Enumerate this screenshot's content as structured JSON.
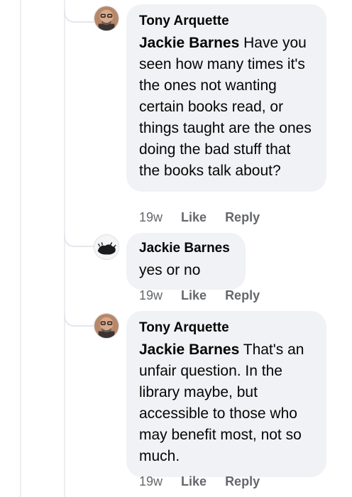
{
  "comments": [
    {
      "author": "Tony Arquette",
      "mention": "Jackie Barnes",
      "text": " Have you seen how many times it's the ones not wanting certain books read, or things taught are the ones doing the bad stuff that the books talk about?",
      "age": "19w",
      "like_label": "Like",
      "reply_label": "Reply",
      "avatar_icon": "profile-photo-man-glasses"
    },
    {
      "author": "Jackie Barnes",
      "mention": "",
      "text": "yes or no",
      "age": "19w",
      "like_label": "Like",
      "reply_label": "Reply",
      "avatar_icon": "profile-photo-dark-animal"
    },
    {
      "author": "Tony Arquette",
      "mention": "Jackie Barnes",
      "text": " That's an unfair question. In the library maybe, but accessible to those who may benefit most, not so much.",
      "age": "19w",
      "like_label": "Like",
      "reply_label": "Reply",
      "avatar_icon": "profile-photo-man-glasses"
    }
  ],
  "colors": {
    "bubble": "#f0f2f5",
    "meta_text": "#65676b",
    "thread_line": "#e4e6ea"
  }
}
